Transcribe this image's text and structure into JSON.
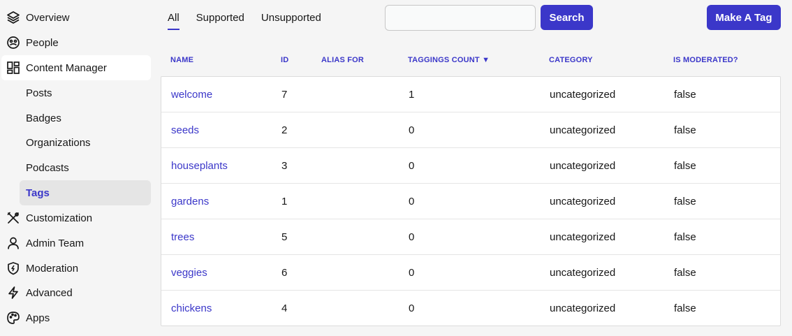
{
  "sidebar": {
    "items": [
      {
        "label": "Overview",
        "icon": "layers-icon"
      },
      {
        "label": "People",
        "icon": "people-icon"
      },
      {
        "label": "Content Manager",
        "icon": "dashboard-icon"
      },
      {
        "label": "Customization",
        "icon": "tools-icon"
      },
      {
        "label": "Admin Team",
        "icon": "user-icon"
      },
      {
        "label": "Moderation",
        "icon": "shield-icon"
      },
      {
        "label": "Advanced",
        "icon": "bolt-icon"
      },
      {
        "label": "Apps",
        "icon": "palette-icon"
      }
    ],
    "sub_items": [
      {
        "label": "Posts"
      },
      {
        "label": "Badges"
      },
      {
        "label": "Organizations"
      },
      {
        "label": "Podcasts"
      },
      {
        "label": "Tags"
      }
    ]
  },
  "tabs": [
    {
      "label": "All"
    },
    {
      "label": "Supported"
    },
    {
      "label": "Unsupported"
    }
  ],
  "search": {
    "value": "",
    "button_label": "Search"
  },
  "make_tag_label": "Make A Tag",
  "accent_color": "#3b37c9",
  "table": {
    "headers": {
      "name": "NAME",
      "id": "ID",
      "alias": "ALIAS FOR",
      "count": "TAGGINGS COUNT ▼",
      "category": "CATEGORY",
      "moderated": "IS MODERATED?"
    },
    "rows": [
      {
        "name": "welcome",
        "id": "7",
        "alias": "",
        "count": "1",
        "category": "uncategorized",
        "moderated": "false"
      },
      {
        "name": "seeds",
        "id": "2",
        "alias": "",
        "count": "0",
        "category": "uncategorized",
        "moderated": "false"
      },
      {
        "name": "houseplants",
        "id": "3",
        "alias": "",
        "count": "0",
        "category": "uncategorized",
        "moderated": "false"
      },
      {
        "name": "gardens",
        "id": "1",
        "alias": "",
        "count": "0",
        "category": "uncategorized",
        "moderated": "false"
      },
      {
        "name": "trees",
        "id": "5",
        "alias": "",
        "count": "0",
        "category": "uncategorized",
        "moderated": "false"
      },
      {
        "name": "veggies",
        "id": "6",
        "alias": "",
        "count": "0",
        "category": "uncategorized",
        "moderated": "false"
      },
      {
        "name": "chickens",
        "id": "4",
        "alias": "",
        "count": "0",
        "category": "uncategorized",
        "moderated": "false"
      }
    ]
  }
}
